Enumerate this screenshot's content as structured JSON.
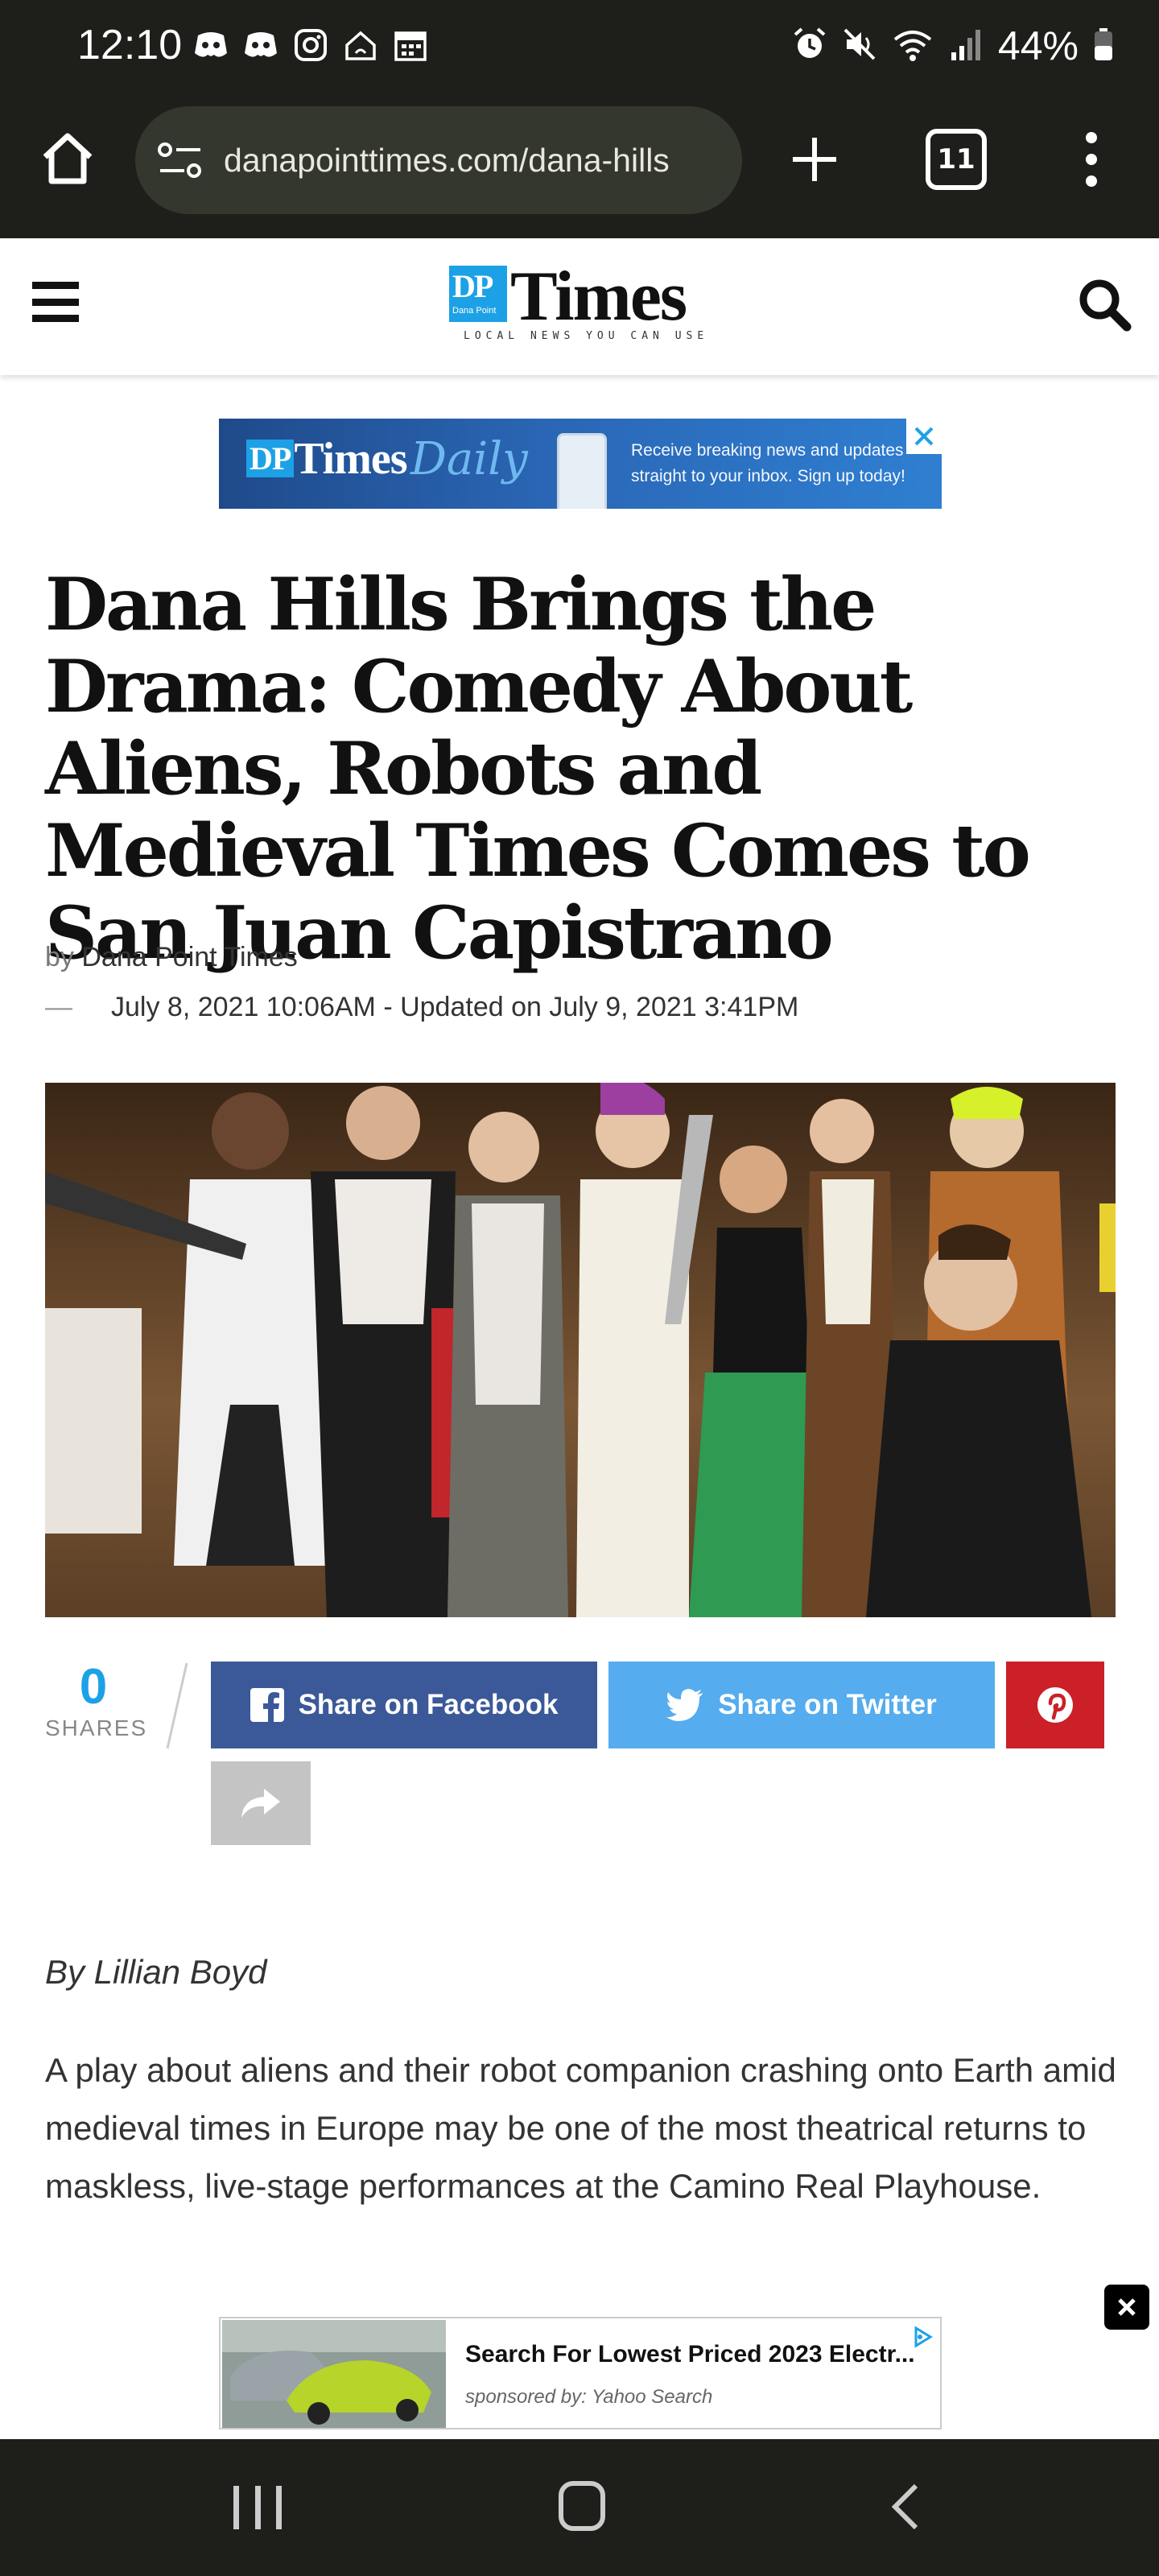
{
  "status_bar": {
    "time": "12:10",
    "battery": "44%",
    "left_icons": [
      "discord-icon",
      "discord-icon",
      "instagram-icon",
      "smart-home-icon",
      "calendar-icon"
    ],
    "right_icons": [
      "alarm-icon",
      "mute-icon",
      "wifi-icon",
      "signal-icon",
      "battery-icon"
    ]
  },
  "browser": {
    "url": "danapointtimes.com/dana-hills",
    "tab_count": "11"
  },
  "site": {
    "logo_badge": "DP",
    "logo_badge_small": "Dana Point",
    "logo_word": "Times",
    "tagline": "LOCAL NEWS YOU CAN USE",
    "accent_color": "#1da1e6"
  },
  "top_ad": {
    "brand_badge": "DP",
    "brand_word": "Times",
    "brand_script": "Daily",
    "line1": "Receive breaking news and updates",
    "line2": "straight to your inbox. Sign up today!"
  },
  "article": {
    "headline": "Dana Hills Brings the Drama: Comedy About Aliens, Robots and Medieval Times Comes to San Juan Capistrano",
    "by_prefix": "by",
    "publisher": "Dana Point Times",
    "date_dash": "—",
    "dates": "July 8, 2021 10:06AM - Updated on July 9, 2021 3:41PM",
    "author": "By Lillian Boyd",
    "paragraph": "A play about aliens and their robot companion crashing onto Earth amid medieval times in Europe may be one of the most theatrical returns to maskless, live-stage performances at the Camino Real Playhouse."
  },
  "share": {
    "count": "0",
    "count_label": "SHARES",
    "facebook_label": "Share on Facebook",
    "twitter_label": "Share on Twitter",
    "colors": {
      "facebook": "#3b5998",
      "twitter": "#55acee",
      "pinterest": "#cb2027"
    }
  },
  "bottom_ad": {
    "title": "Search For Lowest Priced 2023 Electr...",
    "sponsor": "sponsored by: Yahoo Search"
  }
}
